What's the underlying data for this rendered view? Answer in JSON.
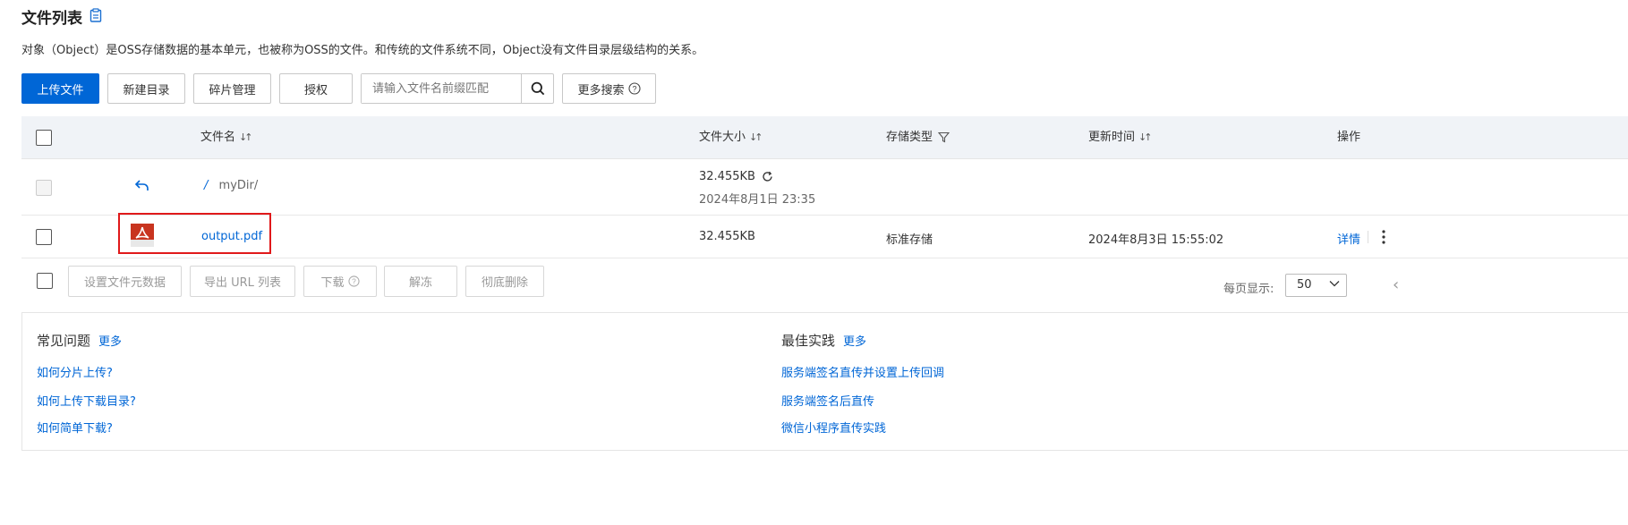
{
  "header": {
    "title": "文件列表",
    "title_icon": "clipboard-icon",
    "description": "对象（Object）是OSS存储数据的基本单元，也被称为OSS的文件。和传统的文件系统不同，Object没有文件目录层级结构的关系。"
  },
  "toolbar": {
    "upload_label": "上传文件",
    "new_dir_label": "新建目录",
    "fragments_label": "碎片管理",
    "auth_label": "授权",
    "search_placeholder": "请输入文件名前缀匹配",
    "more_search_label": "更多搜索"
  },
  "table": {
    "columns": {
      "name": "文件名",
      "size": "文件大小",
      "storage": "存储类型",
      "updated": "更新时间",
      "actions": "操作"
    },
    "parent_row": {
      "path_sep": "/",
      "name": "myDir/",
      "size": "32.455KB",
      "time": "2024年8月1日 23:35"
    },
    "rows": [
      {
        "name": "output.pdf",
        "size": "32.455KB",
        "storage": "标准存储",
        "updated": "2024年8月3日 15:55:02",
        "detail": "详情"
      }
    ]
  },
  "bulk_actions": {
    "set_meta": "设置文件元数据",
    "export_urls": "导出 URL 列表",
    "download": "下载",
    "unfreeze": "解冻",
    "delete_all": "彻底删除"
  },
  "pagination": {
    "per_page_label": "每页显示:",
    "per_page_value": "50"
  },
  "faq": {
    "title": "常见问题",
    "more": "更多",
    "links": [
      "如何分片上传?",
      "如何上传下载目录?",
      "如何简单下载?"
    ]
  },
  "best_practice": {
    "title": "最佳实践",
    "more": "更多",
    "links": [
      "服务端签名直传并设置上传回调",
      "服务端签名后直传",
      "微信小程序直传实践"
    ]
  },
  "colors": {
    "primary": "#0066d6",
    "highlight_border": "#e0191a",
    "pdf_icon": "#c8341f"
  }
}
